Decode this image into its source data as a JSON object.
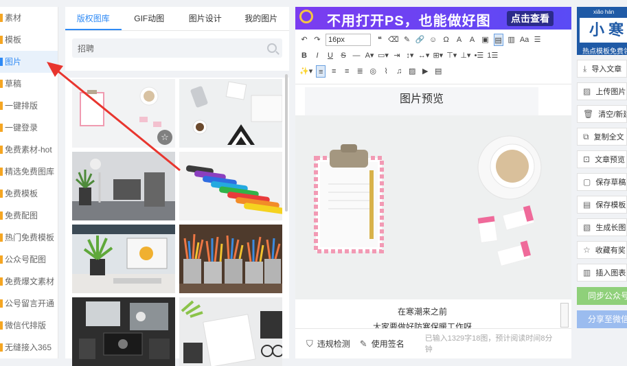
{
  "sidebar": {
    "items": [
      {
        "label": "素材"
      },
      {
        "label": "模板"
      },
      {
        "label": "图片"
      },
      {
        "label": "草稿"
      },
      {
        "label": "一键排版"
      },
      {
        "label": "一键登录"
      },
      {
        "label": "免费素材-hot"
      },
      {
        "label": "精选免费图库"
      },
      {
        "label": "免费模板"
      },
      {
        "label": "免费配图"
      },
      {
        "label": "热门免费模板"
      },
      {
        "label": "公众号配图"
      },
      {
        "label": "免费爆文素材"
      },
      {
        "label": "公号留言开通"
      },
      {
        "label": "微信代排版"
      },
      {
        "label": "无缝接入365"
      }
    ],
    "active_index": 2,
    "dot_colors": [
      "#f5a623",
      "#f5a623",
      "#2f8af5",
      "#f5a623",
      "#f5a623",
      "#f5a623",
      "#f5a623",
      "#f5a623",
      "#f5a623",
      "#f5a623",
      "#f5a623",
      "#f5a623",
      "#f5a623",
      "#f5a623",
      "#f5a623",
      "#f5a623"
    ]
  },
  "library": {
    "tabs": [
      "版权图库",
      "GIF动图",
      "图片设计",
      "我的图片"
    ],
    "active_tab": 0,
    "search_value": "招聘",
    "thumbnails": [
      {
        "name": "clipboard-coffee",
        "starred": true
      },
      {
        "name": "desk-keyboard",
        "starred": false
      },
      {
        "name": "desk-lamp-plant",
        "starred": false
      },
      {
        "name": "markers-rainbow",
        "starred": false
      },
      {
        "name": "plant-monitor-desk",
        "starred": false
      },
      {
        "name": "pencil-cups",
        "starred": false
      },
      {
        "name": "workstation-laptop",
        "starred": false
      },
      {
        "name": "notebook-glasses",
        "starred": false
      }
    ]
  },
  "editor": {
    "banner_text": "不用打开PS，也能做好图",
    "banner_button": "点击查看",
    "font_size": "16px",
    "preview_title": "图片预览",
    "para1": "在寒潮来之前",
    "para2": "大家要做好防寒保暖工作呀",
    "footer": {
      "check_label": "违规检测",
      "sign_label": "使用签名",
      "count_text": "已输入1329字18图，预计阅读时间8分钟"
    }
  },
  "right_panel": {
    "promo_top": "xiǎo   hán",
    "promo_big": "小 寒",
    "promo_bottom": "热点模板免费领",
    "buttons": [
      {
        "label": "导入文章",
        "icon": "import-icon"
      },
      {
        "label": "上传图片",
        "icon": "upload-image-icon"
      },
      {
        "label": "清空/新建",
        "icon": "trash-icon"
      },
      {
        "label": "复制全文",
        "icon": "copy-icon"
      },
      {
        "label": "文章预览",
        "icon": "preview-icon"
      },
      {
        "label": "保存草稿",
        "icon": "save-draft-icon"
      },
      {
        "label": "保存模板",
        "icon": "save-template-icon"
      },
      {
        "label": "生成长图",
        "icon": "long-image-icon"
      },
      {
        "label": "收藏有奖",
        "icon": "star-icon"
      },
      {
        "label": "插入图表",
        "icon": "chart-icon"
      }
    ],
    "sync_label": "同步公众号",
    "share_label": "分享至微信"
  },
  "colors": {
    "accent": "#2f8af5",
    "green": "#8fd07a",
    "annotation": "#e8352e"
  }
}
